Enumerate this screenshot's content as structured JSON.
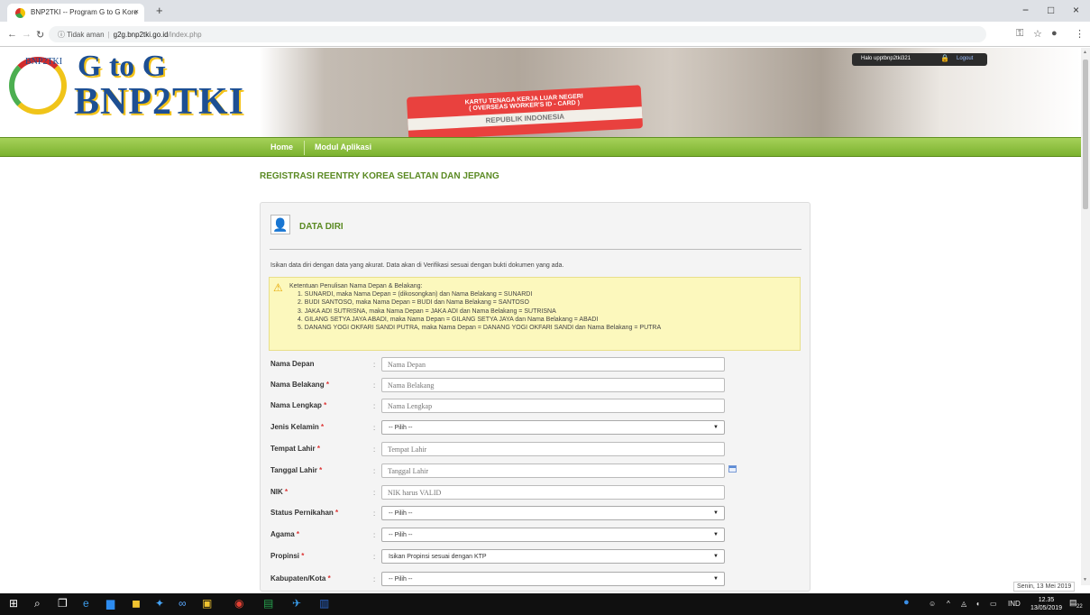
{
  "browser": {
    "tab_title": "BNP2TKI -- Program G to G Kore",
    "tab_close": "×",
    "new_tab": "+",
    "window_controls": [
      "−",
      "□",
      "×"
    ],
    "security_label": "Tidak aman",
    "url_host": "g2g.bnp2tki.go.id",
    "url_path": "/index.php"
  },
  "header": {
    "logo_text": "BNP2TKI",
    "brand_line1": "G to G",
    "brand_line2": "BNP2TKI",
    "card_line1": "KARTU TENAGA KERJA LUAR NEGERI",
    "card_line2": "( OVERSEAS WORKER'S ID - CARD )",
    "card_line3": "REPUBLIK INDONESIA",
    "greeting": "Halo upptbnp2tki321",
    "logout_label": "Logout"
  },
  "menu": {
    "items": [
      "Home",
      "Modul Aplikasi"
    ]
  },
  "page_title": "REGISTRASI REENTRY KOREA SELATAN DAN JEPANG",
  "panel": {
    "title": "DATA DIRI",
    "intro": "Isikan data diri dengan data yang akurat. Data akan di Verifikasi sesuai dengan bukti dokumen yang ada.",
    "note": {
      "heading": "Ketentuan Penulisan Nama Depan & Belakang:",
      "rules": [
        "1. SUNARDI, maka Nama Depan = (dikosongkan) dan Nama Belakang = SUNARDI",
        "2. BUDI SANTOSO, maka Nama Depan = BUDI dan Nama Belakang = SANTOSO",
        "3. JAKA ADI SUTRISNA, maka Nama Depan = JAKA ADI dan Nama Belakang = SUTRISNA",
        "4. GILANG SETYA JAYA ABADI, maka Nama Depan = GILANG SETYA JAYA dan Nama Belakang = ABADI",
        "5. DANANG YOGI OKFARI SANDI PUTRA, maka Nama Depan = DANANG YOGI OKFARI SANDI dan Nama Belakang = PUTRA"
      ]
    }
  },
  "form": {
    "colon": ":",
    "required_mark": "*",
    "fields": [
      {
        "label": "Nama Depan",
        "type": "text",
        "placeholder": "Nama Depan"
      },
      {
        "label": "Nama Belakang",
        "type": "text",
        "placeholder": "Nama Belakang"
      },
      {
        "label": "Nama Lengkap",
        "type": "text",
        "placeholder": "Nama Lengkap"
      },
      {
        "label": "Jenis Kelamin",
        "type": "select",
        "value": "-- Pilih --"
      },
      {
        "label": "Tempat Lahir",
        "type": "text",
        "placeholder": "Tempat Lahir"
      },
      {
        "label": "Tanggal Lahir",
        "type": "text",
        "placeholder": "Tanggal Lahir"
      },
      {
        "label": "NIK",
        "type": "text",
        "placeholder": "NIK harus VALID"
      },
      {
        "label": "Status Pernikahan",
        "type": "select",
        "value": "-- Pilih --"
      },
      {
        "label": "Agama",
        "type": "select",
        "value": "-- Pilih --"
      },
      {
        "label": "Propinsi",
        "type": "select",
        "value": "Isikan Propinsi sesuai dengan KTP"
      },
      {
        "label": "Kabupaten/Kota",
        "type": "select",
        "value": "-- Pilih --"
      }
    ]
  },
  "taskbar": {
    "tooltip": "Senin, 13 Mei 2019",
    "language": "IND",
    "time": "12.35",
    "date": "13/05/2019",
    "notifications": "22"
  }
}
